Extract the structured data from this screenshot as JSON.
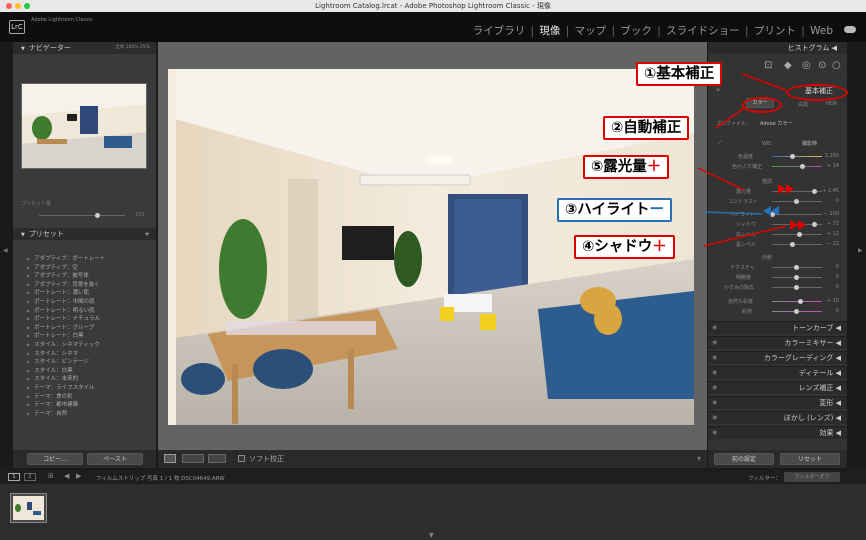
{
  "window": {
    "title": "Lightroom Catalog.lrcat - Adobe Photoshop Lightroom Classic - 現像"
  },
  "app": {
    "logo": "LrC",
    "logo_text": "Adobe Lightroom Classic"
  },
  "modules": {
    "library": "ライブラリ",
    "develop": "現像",
    "map": "マップ",
    "book": "ブック",
    "slideshow": "スライドショー",
    "print": "プリント",
    "web": "Web",
    "sep": "|"
  },
  "left": {
    "navigator": {
      "title": "ナビゲーター",
      "opts": "全体  100%  25%"
    },
    "snapshot_label": "プリセット量",
    "snapshot_value": "100",
    "presets": {
      "title": "プリセット",
      "add": "+",
      "items": [
        "アダプティブ：ポートレート",
        "アダプティブ：空",
        "アダプティブ：被写体",
        "アダプティブ：背景を抜く",
        "ポートレート：濃い肌",
        "ポートレート：中間の肌",
        "ポートレート：明るい肌",
        "ポートレート：ナチュラル",
        "ポートレート：グループ",
        "ポートレート：白黒",
        "スタイル：シネマティック",
        "スタイル：シネマ",
        "スタイル：ビンテージ",
        "スタイル：白黒",
        "スタイル：未来的",
        "テーマ：ライフスタイル",
        "テーマ：食の彩",
        "テーマ：都市建築",
        "テーマ：自然"
      ]
    },
    "copy": "コピー...",
    "paste": "ペースト"
  },
  "toolbar": {
    "soft_proof": "ソフト校正"
  },
  "right": {
    "histogram": "ヒストグラム",
    "basic": "基本補正",
    "treatment_color": "カラー",
    "treatment_bw": "白黒",
    "hdr": "HDR",
    "auto": "自動補正",
    "profile_label": "プロファイル：",
    "profile_value": "Adobe カラー",
    "wb_label": "WB：",
    "wb_value": "撮影時",
    "temp_label": "色温度",
    "temp_value": "3,250",
    "tint_label": "色かぶり補正",
    "tint_value": "+ 14",
    "tone": "階調",
    "sliders": [
      {
        "label": "露光量",
        "value": "+ 2.45"
      },
      {
        "label": "コントラスト",
        "value": "0"
      },
      {
        "label": "ハイライト",
        "value": "− 100"
      },
      {
        "label": "シャドウ",
        "value": "+ 72"
      },
      {
        "label": "白レベル",
        "value": "+ 12"
      },
      {
        "label": "黒レベル",
        "value": "− 22"
      }
    ],
    "presence": "外観",
    "presence_sliders": [
      {
        "label": "テクスチャ",
        "value": "0"
      },
      {
        "label": "明瞭度",
        "value": "0"
      },
      {
        "label": "かすみの除去",
        "value": "0"
      },
      {
        "label": "自然な彩度",
        "value": "+ 10"
      },
      {
        "label": "彩度",
        "value": "0"
      }
    ],
    "sections": [
      "トーンカーブ",
      "カラーミキサー",
      "カラーグレーディング",
      "ディテール",
      "レンズ補正",
      "変形",
      "ぼかし (レンズ)",
      "効果"
    ],
    "prev": "前の設定",
    "reset": "リセット"
  },
  "filmstrip": {
    "path": "フィルムストリップ   写真 1 / 1 枚  DSC04649.ARW",
    "filter_label": "フィルター：",
    "filter_value": "フィルターオフ"
  },
  "annotations": {
    "basic": "①基本補正",
    "auto": "②自動補正",
    "highlights": "③ハイライト",
    "highlights_sign": "ー",
    "shadows": "④シャドウ",
    "shadows_sign": "＋",
    "exposure": "⑤露光量",
    "exposure_sign": "＋"
  },
  "colors": {
    "annotation_red": "#d00000",
    "annotation_blue": "#2670b8"
  }
}
